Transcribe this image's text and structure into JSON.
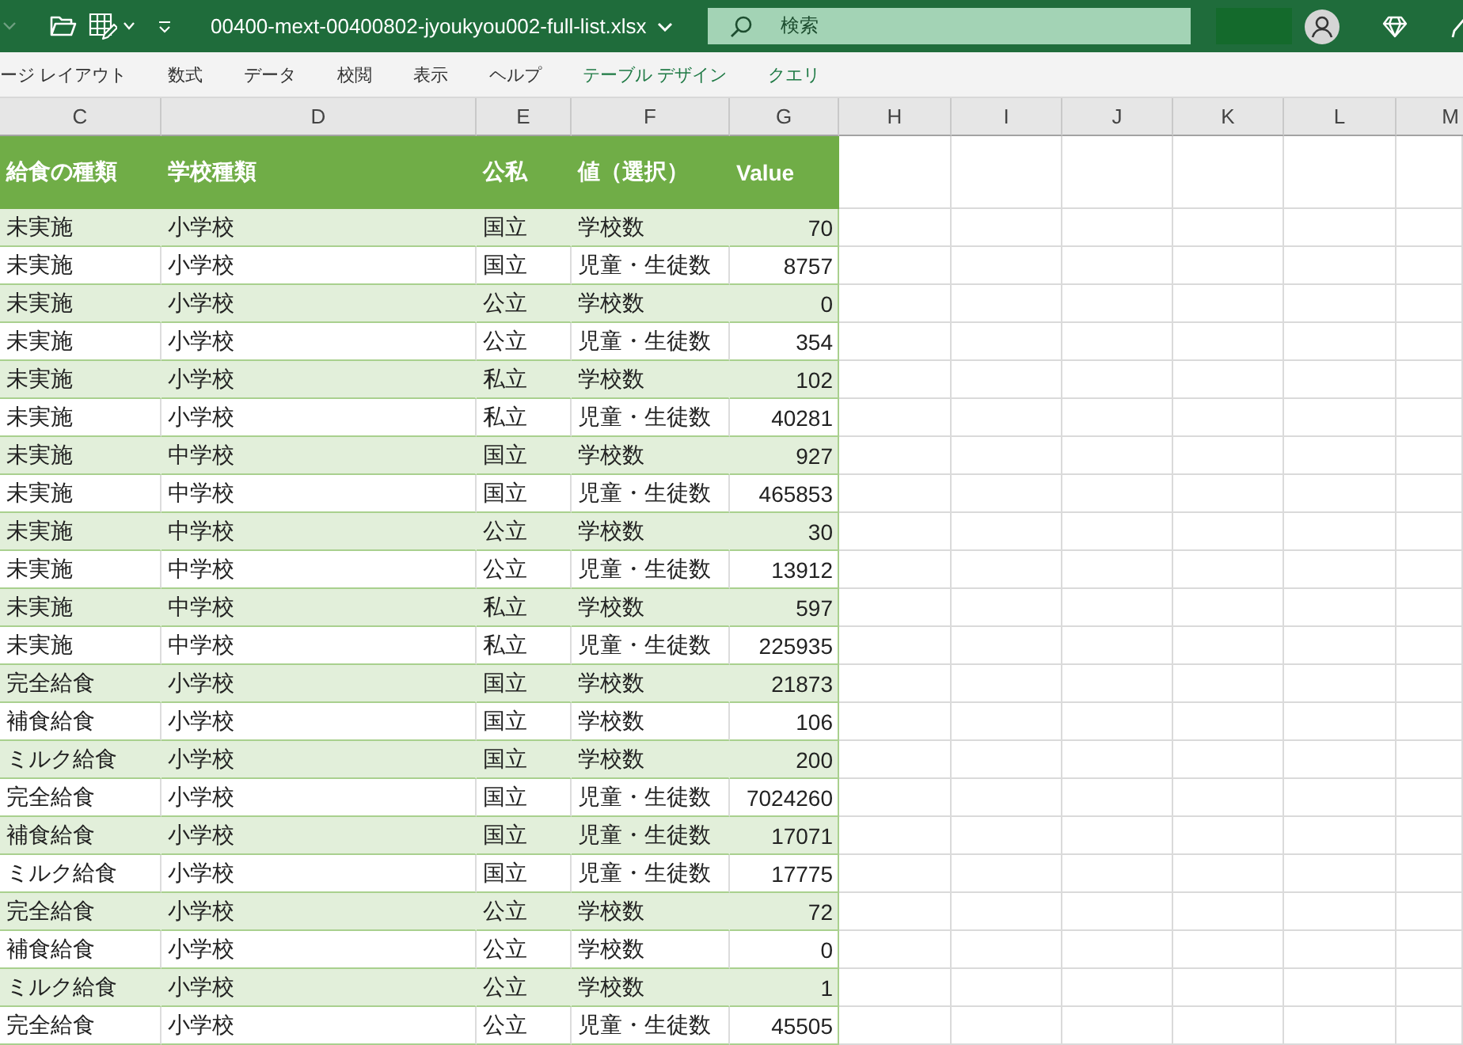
{
  "title_bar": {
    "title": "00400-mext-00400802-jyoukyou002-full-list.xlsx",
    "search": {
      "placeholder": "検索"
    }
  },
  "ribbon_tabs": [
    {
      "label": "ージ レイアウト",
      "kind": "standard"
    },
    {
      "label": "数式",
      "kind": "standard"
    },
    {
      "label": "データ",
      "kind": "standard"
    },
    {
      "label": "校閲",
      "kind": "standard"
    },
    {
      "label": "表示",
      "kind": "standard"
    },
    {
      "label": "ヘルプ",
      "kind": "standard"
    },
    {
      "label": "テーブル デザイン",
      "kind": "contextual"
    },
    {
      "label": "クエリ",
      "kind": "contextual"
    }
  ],
  "sheet": {
    "column_letters": [
      "C",
      "D",
      "E",
      "F",
      "G",
      "H",
      "I",
      "J",
      "K",
      "L",
      "M"
    ],
    "table": {
      "columns": [
        "給食の種類",
        "学校種類",
        "公私",
        "値（選択）",
        "Value"
      ],
      "rows": [
        [
          "未実施",
          "小学校",
          "国立",
          "学校数",
          "70"
        ],
        [
          "未実施",
          "小学校",
          "国立",
          "児童・生徒数",
          "8757"
        ],
        [
          "未実施",
          "小学校",
          "公立",
          "学校数",
          "0"
        ],
        [
          "未実施",
          "小学校",
          "公立",
          "児童・生徒数",
          "354"
        ],
        [
          "未実施",
          "小学校",
          "私立",
          "学校数",
          "102"
        ],
        [
          "未実施",
          "小学校",
          "私立",
          "児童・生徒数",
          "40281"
        ],
        [
          "未実施",
          "中学校",
          "国立",
          "学校数",
          "927"
        ],
        [
          "未実施",
          "中学校",
          "国立",
          "児童・生徒数",
          "465853"
        ],
        [
          "未実施",
          "中学校",
          "公立",
          "学校数",
          "30"
        ],
        [
          "未実施",
          "中学校",
          "公立",
          "児童・生徒数",
          "13912"
        ],
        [
          "未実施",
          "中学校",
          "私立",
          "学校数",
          "597"
        ],
        [
          "未実施",
          "中学校",
          "私立",
          "児童・生徒数",
          "225935"
        ],
        [
          "完全給食",
          "小学校",
          "国立",
          "学校数",
          "21873"
        ],
        [
          "補食給食",
          "小学校",
          "国立",
          "学校数",
          "106"
        ],
        [
          "ミルク給食",
          "小学校",
          "国立",
          "学校数",
          "200"
        ],
        [
          "完全給食",
          "小学校",
          "国立",
          "児童・生徒数",
          "7024260"
        ],
        [
          "補食給食",
          "小学校",
          "国立",
          "児童・生徒数",
          "17071"
        ],
        [
          "ミルク給食",
          "小学校",
          "国立",
          "児童・生徒数",
          "17775"
        ],
        [
          "完全給食",
          "小学校",
          "公立",
          "学校数",
          "72"
        ],
        [
          "補食給食",
          "小学校",
          "公立",
          "学校数",
          "0"
        ],
        [
          "ミルク給食",
          "小学校",
          "公立",
          "学校数",
          "1"
        ],
        [
          "完全給食",
          "小学校",
          "公立",
          "児童・生徒数",
          "45505"
        ]
      ]
    }
  }
}
